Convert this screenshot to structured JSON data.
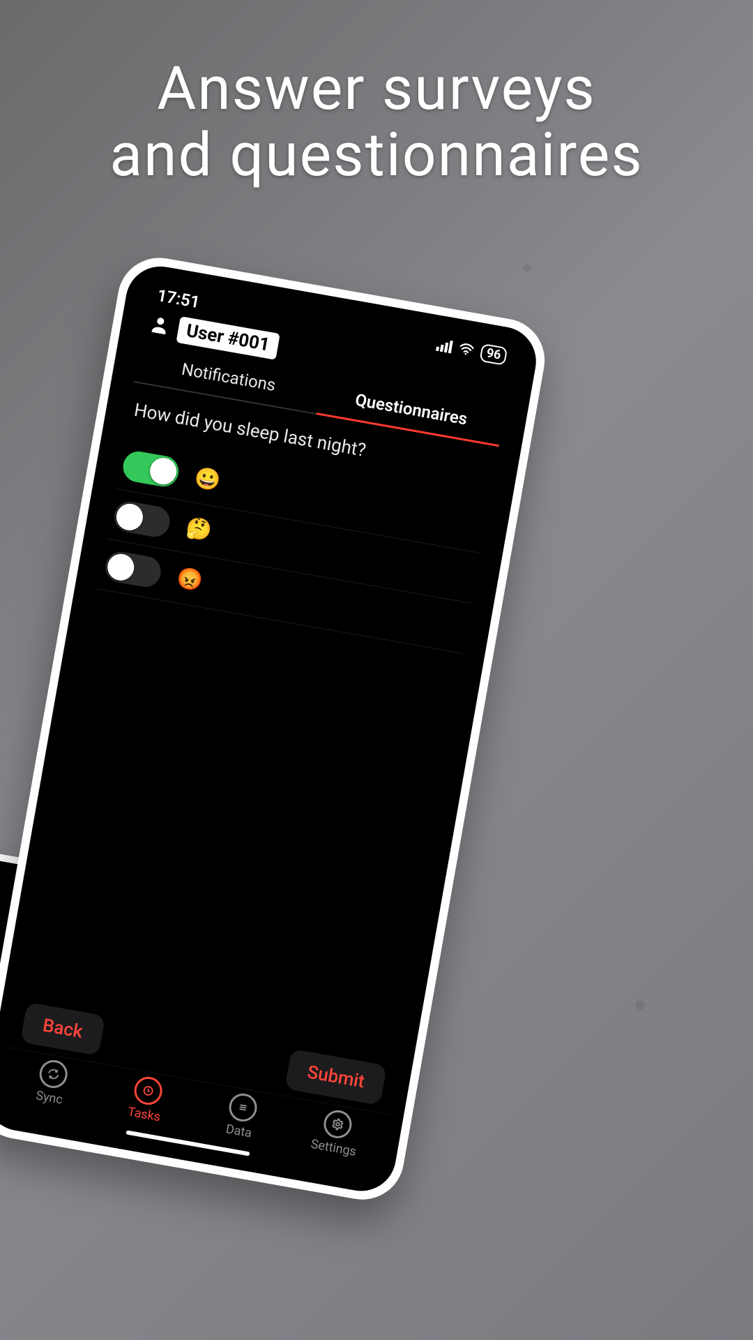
{
  "marketing": {
    "headline_line1": "Answer surveys",
    "headline_line2": "and questionnaires"
  },
  "status": {
    "time": "17:51",
    "battery": "96"
  },
  "header": {
    "user_label": "User #001"
  },
  "tabs": {
    "notifications_label": "Notifications",
    "questionnaires_label": "Questionnaires"
  },
  "question": {
    "text": "How did you sleep last night?"
  },
  "options": [
    {
      "emoji": "😀",
      "on": true
    },
    {
      "emoji": "🤔",
      "on": false
    },
    {
      "emoji": "😡",
      "on": false
    }
  ],
  "actions": {
    "back_label": "Back",
    "submit_label": "Submit"
  },
  "nav": {
    "sync_label": "Sync",
    "tasks_label": "Tasks",
    "data_label": "Data",
    "settings_label": "Settings"
  }
}
